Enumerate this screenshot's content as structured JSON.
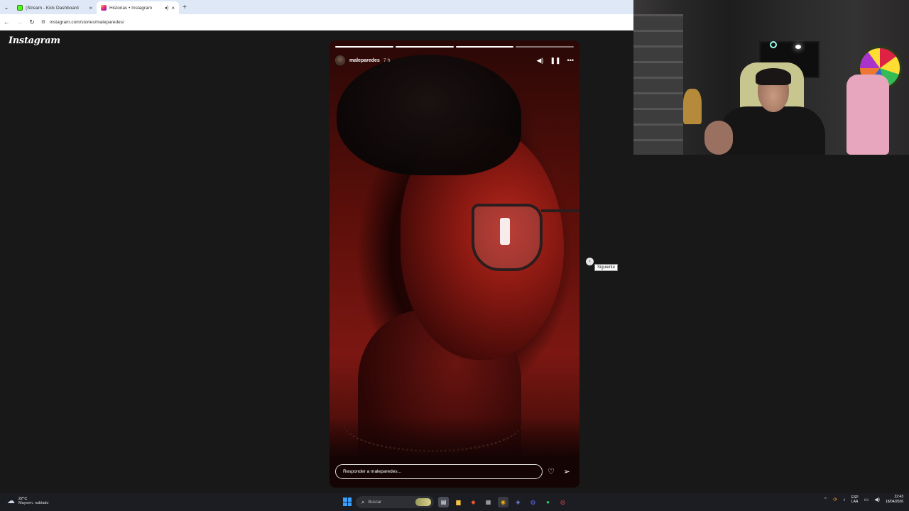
{
  "browser": {
    "tabs": [
      {
        "label": "(Stream - Kick Dashboard",
        "favicon": "kick-icon",
        "active": false
      },
      {
        "label": "Historias • Instagram",
        "favicon": "instagram-icon",
        "active": true
      }
    ],
    "url": "instagram.com/stories/maleparedes/"
  },
  "page": {
    "logo": "Instagram",
    "story": {
      "username": "maleparedes",
      "time": "7 h",
      "segments": [
        1,
        1,
        1,
        0
      ],
      "reply_placeholder": "Responder a maleparedes...",
      "accent": "#b8271c"
    },
    "next_tooltip": "Siguiente"
  },
  "taskbar": {
    "weather_temp": "22°C",
    "weather_cond": "Mayorm. nublado",
    "search_placeholder": "Buscar",
    "lang_top": "ESP",
    "lang_bottom": "LAA",
    "time": "22:43",
    "date": "18/04/2026",
    "icons": [
      "file-explorer-icon",
      "folder-icon",
      "brave-icon",
      "calculator-icon",
      "chrome-icon",
      "teams-icon",
      "discord-icon",
      "spotify-icon",
      "app-icon"
    ]
  }
}
